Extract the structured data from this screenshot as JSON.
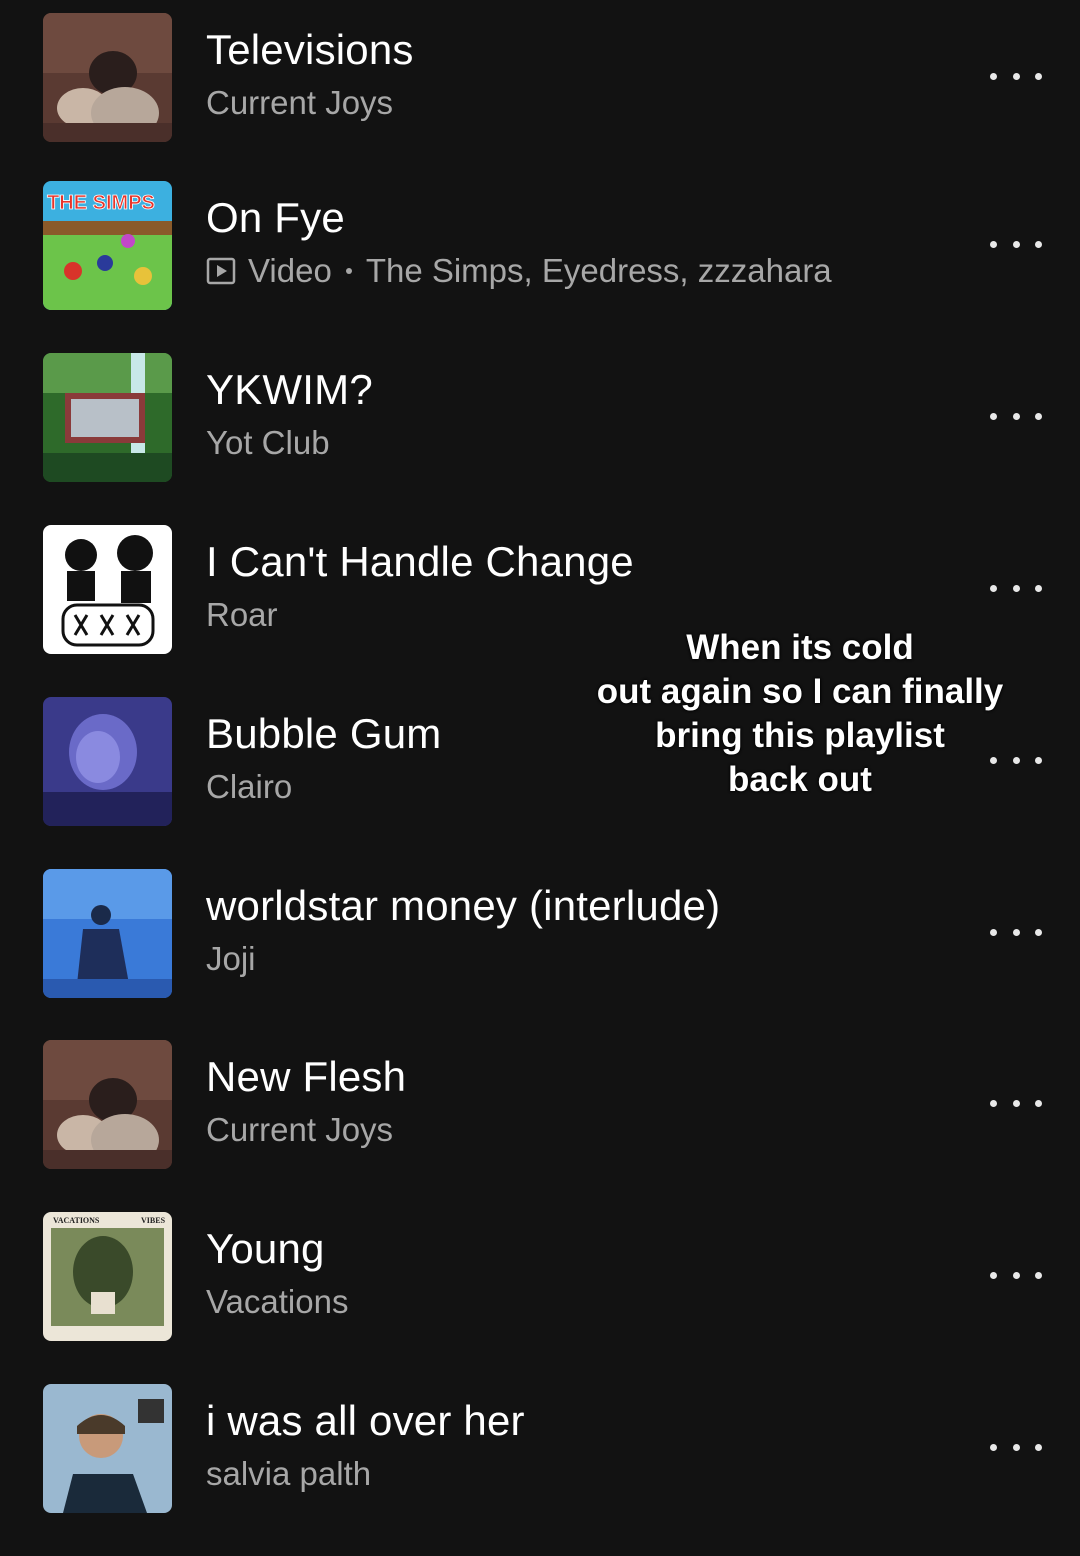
{
  "tracks": [
    {
      "title": "Televisions",
      "artist": "Current Joys",
      "art": "current-joys-cover-art"
    },
    {
      "title": "On Fye",
      "type_label": "Video",
      "artist": "The Simps, Eyedress, zzzahara",
      "art": "the-simps-cover-art",
      "art_text": "THE SIMPS"
    },
    {
      "title": "YKWIM?",
      "artist": "Yot Club",
      "art": "yot-club-cover-art"
    },
    {
      "title": "I Can't Handle Change",
      "artist": "Roar",
      "art": "roar-cover-art"
    },
    {
      "title": "Bubble Gum",
      "artist": "Clairo",
      "art": "clairo-cover-art"
    },
    {
      "title": "worldstar money (interlude)",
      "artist": "Joji",
      "art": "joji-cover-art"
    },
    {
      "title": "New Flesh",
      "artist": "Current Joys",
      "art": "current-joys-cover-art"
    },
    {
      "title": "Young",
      "artist": "Vacations",
      "art": "vacations-cover-art",
      "art_text": [
        "VACATIONS",
        "VIBES"
      ]
    },
    {
      "title": "i was all over her",
      "artist": "salvia palth",
      "art": "salvia-palth-cover-art"
    }
  ],
  "overlay_caption": [
    "When its cold",
    "out again so I can finally",
    "bring this playlist",
    "back out"
  ],
  "icons": {
    "more": "more-options-icon",
    "video": "video-icon"
  },
  "colors": {
    "background": "#121212",
    "title": "#ffffff",
    "subtitle": "#a7a7a7"
  }
}
